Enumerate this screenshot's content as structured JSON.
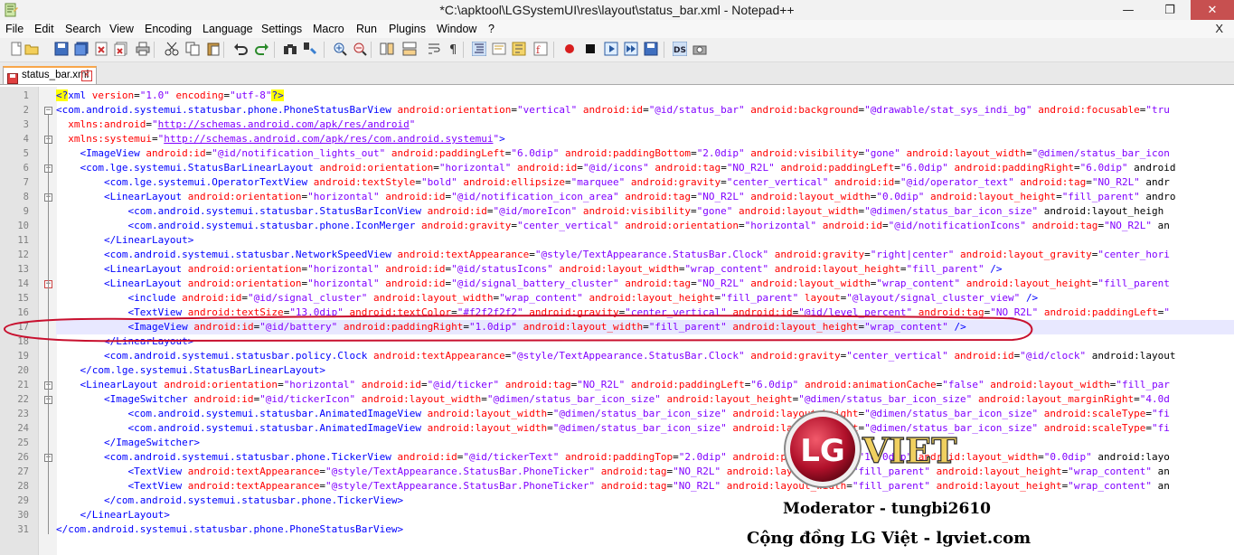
{
  "window": {
    "title": "*C:\\apktool\\LGSystemUI\\res\\layout\\status_bar.xml - Notepad++",
    "controls": {
      "minimize": "—",
      "maximize": "❐",
      "close": "✕"
    }
  },
  "menu": {
    "items": [
      "File",
      "Edit",
      "Search",
      "View",
      "Encoding",
      "Language",
      "Settings",
      "Macro",
      "Run",
      "Plugins",
      "Window",
      "?"
    ],
    "doc_close": "X"
  },
  "toolbar": {
    "buttons": [
      "new-file",
      "open-file",
      "save",
      "save-all",
      "close",
      "close-all",
      "print",
      "cut",
      "copy",
      "paste",
      "undo",
      "redo",
      "find",
      "replace",
      "zoom-in",
      "zoom-out",
      "sync-vertical",
      "sync-horizontal",
      "word-wrap",
      "show-all-chars",
      "indent-guide",
      "user-lang",
      "doc-map",
      "function-list",
      "record-macro",
      "stop-macro",
      "play-macro",
      "run-macro-multiple",
      "save-macro",
      "doc-switcher",
      "spell-check"
    ]
  },
  "tab": {
    "label": "status_bar.xml"
  },
  "editor": {
    "highlighted_line": 17,
    "lines": [
      {
        "n": "1",
        "text": "<?xml version=\"1.0\" encoding=\"utf-8\"?>"
      },
      {
        "n": "2",
        "text": "<com.android.systemui.statusbar.phone.PhoneStatusBarView android:orientation=\"vertical\" android:id=\"@id/status_bar\" android:background=\"@drawable/stat_sys_indi_bg\" android:focusable=\"tru"
      },
      {
        "n": "3",
        "text": "  xmlns:android=\"http://schemas.android.com/apk/res/android\""
      },
      {
        "n": "4",
        "text": "  xmlns:systemui=\"http://schemas.android.com/apk/res/com.android.systemui\">"
      },
      {
        "n": "5",
        "text": "    <ImageView android:id=\"@id/notification_lights_out\" android:paddingLeft=\"6.0dip\" android:paddingBottom=\"2.0dip\" android:visibility=\"gone\" android:layout_width=\"@dimen/status_bar_icon"
      },
      {
        "n": "6",
        "text": "    <com.lge.systemui.StatusBarLinearLayout android:orientation=\"horizontal\" android:id=\"@id/icons\" android:tag=\"NO_R2L\" android:paddingLeft=\"6.0dip\" android:paddingRight=\"6.0dip\" android"
      },
      {
        "n": "7",
        "text": "        <com.lge.systemui.OperatorTextView android:textStyle=\"bold\" android:ellipsize=\"marquee\" android:gravity=\"center_vertical\" android:id=\"@id/operator_text\" android:tag=\"NO_R2L\" andr"
      },
      {
        "n": "8",
        "text": "        <LinearLayout android:orientation=\"horizontal\" android:id=\"@id/notification_icon_area\" android:tag=\"NO_R2L\" android:layout_width=\"0.0dip\" android:layout_height=\"fill_parent\" andro"
      },
      {
        "n": "9",
        "text": "            <com.android.systemui.statusbar.StatusBarIconView android:id=\"@id/moreIcon\" android:visibility=\"gone\" android:layout_width=\"@dimen/status_bar_icon_size\" android:layout_heigh"
      },
      {
        "n": "10",
        "text": "            <com.android.systemui.statusbar.phone.IconMerger android:gravity=\"center_vertical\" android:orientation=\"horizontal\" android:id=\"@id/notificationIcons\" android:tag=\"NO_R2L\" an"
      },
      {
        "n": "11",
        "text": "        </LinearLayout>"
      },
      {
        "n": "12",
        "text": "        <com.android.systemui.statusbar.NetworkSpeedView android:textAppearance=\"@style/TextAppearance.StatusBar.Clock\" android:gravity=\"right|center\" android:layout_gravity=\"center_hori"
      },
      {
        "n": "13",
        "text": "        <LinearLayout android:orientation=\"horizontal\" android:id=\"@id/statusIcons\" android:layout_width=\"wrap_content\" android:layout_height=\"fill_parent\" />"
      },
      {
        "n": "14",
        "text": "        <LinearLayout android:orientation=\"horizontal\" android:id=\"@id/signal_battery_cluster\" android:tag=\"NO_R2L\" android:layout_width=\"wrap_content\" android:layout_height=\"fill_parent"
      },
      {
        "n": "15",
        "text": "            <include android:id=\"@id/signal_cluster\" android:layout_width=\"wrap_content\" android:layout_height=\"fill_parent\" layout=\"@layout/signal_cluster_view\" />"
      },
      {
        "n": "16",
        "text": "            <TextView android:textSize=\"13.0dip\" android:textColor=\"#f2f2f2f2\" android:gravity=\"center_vertical\" android:id=\"@id/level_percent\" android:tag=\"NO_R2L\" android:paddingLeft=\""
      },
      {
        "n": "17",
        "text": "            <ImageView android:id=\"@id/battery\" android:paddingRight=\"1.0dip\" android:layout_width=\"fill_parent\" android:layout_height=\"wrap_content\" />"
      },
      {
        "n": "18",
        "text": "        </LinearLayout>"
      },
      {
        "n": "19",
        "text": "        <com.android.systemui.statusbar.policy.Clock android:textAppearance=\"@style/TextAppearance.StatusBar.Clock\" android:gravity=\"center_vertical\" android:id=\"@id/clock\" android:layout"
      },
      {
        "n": "20",
        "text": "    </com.lge.systemui.StatusBarLinearLayout>"
      },
      {
        "n": "21",
        "text": "    <LinearLayout android:orientation=\"horizontal\" android:id=\"@id/ticker\" android:tag=\"NO_R2L\" android:paddingLeft=\"6.0dip\" android:animationCache=\"false\" android:layout_width=\"fill_par"
      },
      {
        "n": "22",
        "text": "        <ImageSwitcher android:id=\"@id/tickerIcon\" android:layout_width=\"@dimen/status_bar_icon_size\" android:layout_height=\"@dimen/status_bar_icon_size\" android:layout_marginRight=\"4.0d"
      },
      {
        "n": "23",
        "text": "            <com.android.systemui.statusbar.AnimatedImageView android:layout_width=\"@dimen/status_bar_icon_size\" android:layout_height=\"@dimen/status_bar_icon_size\" android:scaleType=\"fi"
      },
      {
        "n": "24",
        "text": "            <com.android.systemui.statusbar.AnimatedImageView android:layout_width=\"@dimen/status_bar_icon_size\" android:layout_height=\"@dimen/status_bar_icon_size\" android:scaleType=\"fi"
      },
      {
        "n": "25",
        "text": "        </ImageSwitcher>"
      },
      {
        "n": "26",
        "text": "        <com.android.systemui.statusbar.phone.TickerView android:id=\"@id/tickerText\" android:paddingTop=\"2.0dip\" android:paddingRight=\"10.0dip\" android:layout_width=\"0.0dip\" android:layo"
      },
      {
        "n": "27",
        "text": "            <TextView android:textAppearance=\"@style/TextAppearance.StatusBar.PhoneTicker\" android:tag=\"NO_R2L\" android:layout_width=\"fill_parent\" android:layout_height=\"wrap_content\" an"
      },
      {
        "n": "28",
        "text": "            <TextView android:textAppearance=\"@style/TextAppearance.StatusBar.PhoneTicker\" android:tag=\"NO_R2L\" android:layout_width=\"fill_parent\" android:layout_height=\"wrap_content\" an"
      },
      {
        "n": "29",
        "text": "        </com.android.systemui.statusbar.phone.TickerView>"
      },
      {
        "n": "30",
        "text": "    </LinearLayout>"
      },
      {
        "n": "31",
        "text": "</com.android.systemui.statusbar.phone.PhoneStatusBarView>"
      }
    ],
    "fold_markers": [
      {
        "line": 2,
        "type": "open"
      },
      {
        "line": 4,
        "type": "open"
      },
      {
        "line": 6,
        "type": "open"
      },
      {
        "line": 8,
        "type": "open"
      },
      {
        "line": 14,
        "type": "open-red"
      },
      {
        "line": 21,
        "type": "open"
      },
      {
        "line": 22,
        "type": "open"
      },
      {
        "line": 26,
        "type": "open"
      }
    ]
  },
  "watermark": {
    "logo_text": "LG",
    "brand": "VIET",
    "moderator": "Moderator - tungbi2610",
    "community": "Cộng đồng LG Việt - lgviet.com"
  },
  "colors": {
    "tag": "#0000ff",
    "attribute": "#ff0000",
    "value": "#8000ff",
    "annotation_red": "#c8102e",
    "tab_accent": "#f8a64a"
  }
}
